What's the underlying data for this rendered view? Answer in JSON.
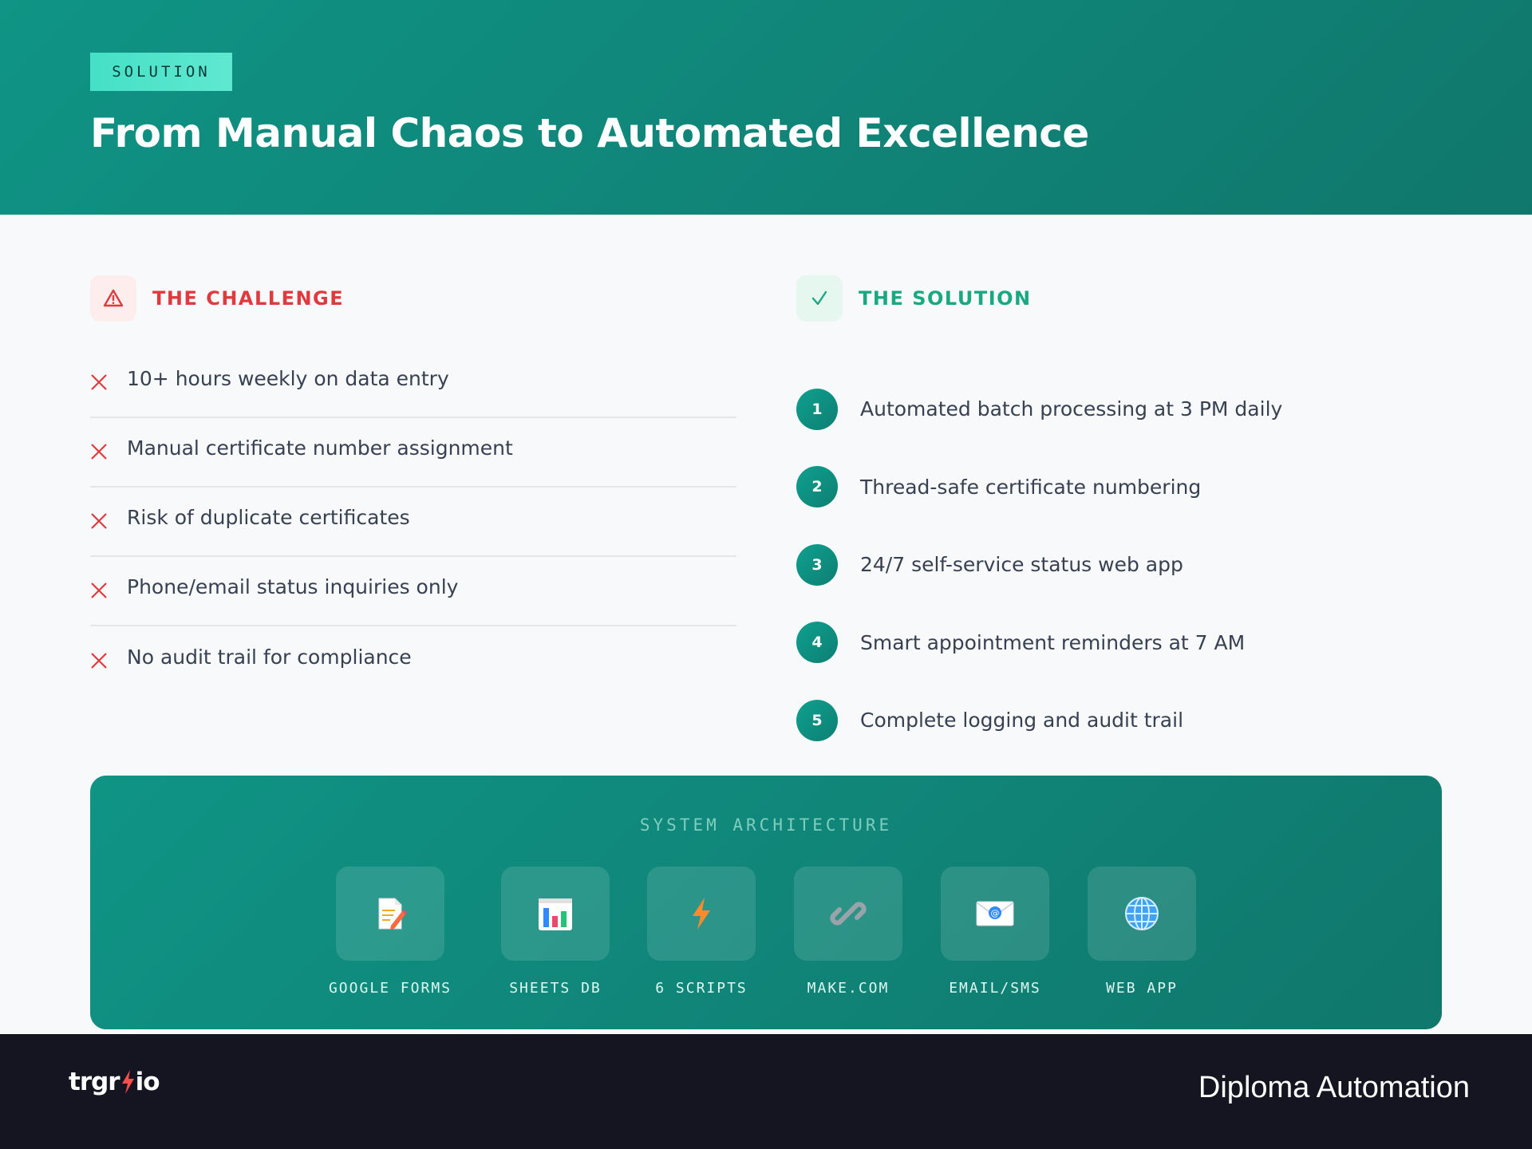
{
  "header": {
    "badge": "SOLUTION",
    "title": "From Manual Chaos to Automated Excellence"
  },
  "challenge": {
    "title": "THE CHALLENGE",
    "icon": "warning-icon",
    "accent": "#e0393e",
    "items": [
      {
        "text": "10+ hours weekly on data entry"
      },
      {
        "text": "Manual certificate number assignment"
      },
      {
        "text": "Risk of duplicate certificates"
      },
      {
        "text": "Phone/email status inquiries only"
      },
      {
        "text": "No audit trail for compliance"
      }
    ]
  },
  "solution": {
    "title": "THE SOLUTION",
    "icon": "checkmark-icon",
    "accent": "#1aa882",
    "items": [
      {
        "num": "1",
        "text": "Automated batch processing at 3 PM daily"
      },
      {
        "num": "2",
        "text": "Thread-safe certificate numbering"
      },
      {
        "num": "3",
        "text": "24/7 self-service status web app"
      },
      {
        "num": "4",
        "text": "Smart appointment reminders at 7 AM"
      },
      {
        "num": "5",
        "text": "Complete logging and audit trail"
      }
    ]
  },
  "architecture": {
    "title": "SYSTEM ARCHITECTURE",
    "items": [
      {
        "label": "GOOGLE FORMS",
        "icon": "memo-icon"
      },
      {
        "label": "SHEETS DB",
        "icon": "bar-chart-icon"
      },
      {
        "label": "6 SCRIPTS",
        "icon": "lightning-icon"
      },
      {
        "label": "MAKE.COM",
        "icon": "link-icon"
      },
      {
        "label": "EMAIL/SMS",
        "icon": "email-icon"
      },
      {
        "label": "WEB APP",
        "icon": "globe-icon"
      }
    ]
  },
  "footer": {
    "brand_left": "trgr",
    "brand_right": "io",
    "product": "Diploma Automation"
  },
  "colors": {
    "primary_teal": "#0f9485",
    "badge_teal": "#45e0c6",
    "footer_dark": "#151522"
  }
}
